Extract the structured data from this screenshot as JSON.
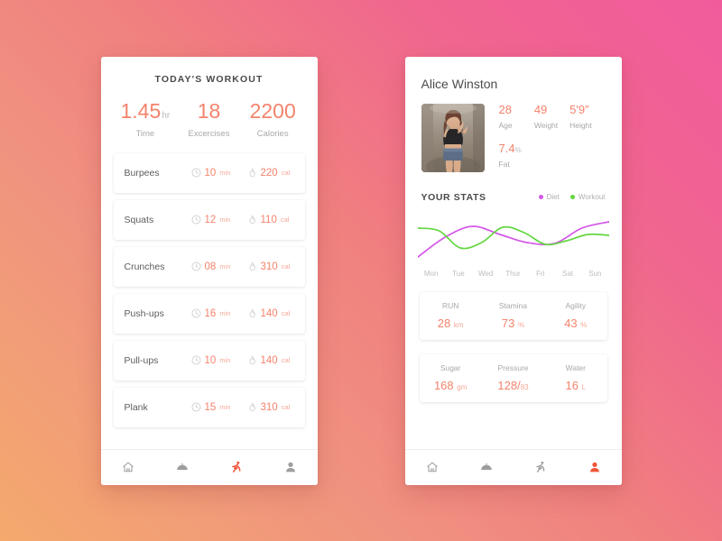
{
  "background": {
    "from": "#f4a96d",
    "to": "#f15b9c"
  },
  "accent": "#f4836c",
  "left_phone": {
    "title": "TODAY'S  WORKOUT",
    "summary": [
      {
        "value": "1.45",
        "unit": "hr",
        "label": "Time"
      },
      {
        "value": "18",
        "unit": "",
        "label": "Excercises"
      },
      {
        "value": "2200",
        "unit": "",
        "label": "Calories"
      }
    ],
    "exercises": [
      {
        "name": "Burpees",
        "time": "10",
        "time_unit": "min",
        "cal": "220",
        "cal_unit": "cal"
      },
      {
        "name": "Squats",
        "time": "12",
        "time_unit": "min",
        "cal": "110",
        "cal_unit": "cal"
      },
      {
        "name": "Crunches",
        "time": "08",
        "time_unit": "min",
        "cal": "310",
        "cal_unit": "cal"
      },
      {
        "name": "Push-ups",
        "time": "16",
        "time_unit": "min",
        "cal": "140",
        "cal_unit": "cal"
      },
      {
        "name": "Pull-ups",
        "time": "10",
        "time_unit": "min",
        "cal": "140",
        "cal_unit": "cal"
      },
      {
        "name": "Plank",
        "time": "15",
        "time_unit": "min",
        "cal": "310",
        "cal_unit": "cal"
      }
    ],
    "nav": [
      {
        "icon": "home-icon",
        "active": false
      },
      {
        "icon": "meal-dome-icon",
        "active": false
      },
      {
        "icon": "running-icon",
        "active": true
      },
      {
        "icon": "profile-icon",
        "active": false
      }
    ]
  },
  "right_phone": {
    "profile": {
      "name": "Alice Winston",
      "photo_alt": "user-photo",
      "stats": [
        {
          "value": "28",
          "unit": "",
          "label": "Age"
        },
        {
          "value": "49",
          "unit": "",
          "label": "Weight"
        },
        {
          "value": "5'9”",
          "unit": "",
          "label": "Height"
        }
      ],
      "fat": {
        "value": "7.4",
        "unit": "%",
        "label": "Fat"
      }
    },
    "stats_section": {
      "title": "YOUR STATS",
      "legend": [
        {
          "label": "Diet",
          "color": "#d456e8"
        },
        {
          "label": "Workout",
          "color": "#63d63f"
        }
      ]
    },
    "cards": [
      [
        {
          "label": "RUN",
          "value": "28",
          "unit": "km"
        },
        {
          "label": "Stamina",
          "value": "73",
          "unit": "%"
        },
        {
          "label": "Agility",
          "value": "43",
          "unit": "%"
        }
      ],
      [
        {
          "label": "Sugar",
          "value": "168",
          "unit": "gm"
        },
        {
          "label": "Pressure",
          "value": "128/",
          "unit": "83"
        },
        {
          "label": "Water",
          "value": "16",
          "unit": "L"
        }
      ]
    ],
    "nav": [
      {
        "icon": "home-icon",
        "active": false
      },
      {
        "icon": "meal-dome-icon",
        "active": false
      },
      {
        "icon": "running-icon",
        "active": false
      },
      {
        "icon": "profile-icon",
        "active": true
      }
    ]
  },
  "chart_data": {
    "type": "line",
    "title": "YOUR STATS",
    "categories": [
      "Mon",
      "Tue",
      "Wed",
      "Thur",
      "Fri",
      "Sat",
      "Sun"
    ],
    "xlabel": "",
    "ylabel": "",
    "ylim": [
      0,
      100
    ],
    "grid": false,
    "legend_position": "top-right",
    "series": [
      {
        "name": "Diet",
        "color": "#d456e8",
        "values": [
          8,
          52,
          76,
          58,
          40,
          38,
          72,
          86
        ]
      },
      {
        "name": "Workout",
        "color": "#63d63f",
        "values": [
          72,
          66,
          28,
          40,
          74,
          62,
          36,
          44,
          58,
          56
        ]
      }
    ]
  }
}
